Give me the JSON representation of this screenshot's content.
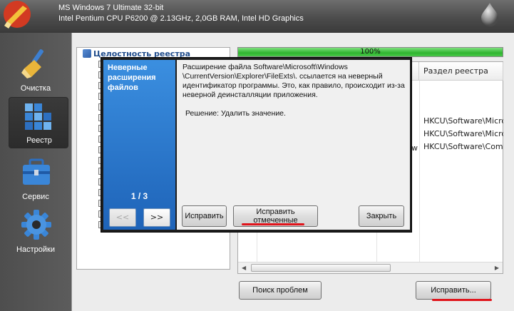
{
  "header": {
    "system_line": "MS Windows 7 Ultimate 32-bit",
    "hardware_line": "Intel Pentium CPU P6200 @ 2.13GHz, 2,0GB RAM, Intel HD Graphics"
  },
  "sidebar": {
    "items": [
      {
        "label": "Очистка",
        "icon": "broom-icon"
      },
      {
        "label": "Реестр",
        "icon": "registry-cubes-icon",
        "active": true
      },
      {
        "label": "Сервис",
        "icon": "toolbox-icon"
      },
      {
        "label": "Настройки",
        "icon": "gear-icon"
      }
    ]
  },
  "tree": {
    "header": "Целостность реестра",
    "checkbox_count": 16
  },
  "progress": {
    "label": "100%",
    "value": 100
  },
  "results": {
    "columns": [
      "Раздел реестра"
    ],
    "rows": [
      {
        "fragment": "",
        "key": "HKCU\\Software\\Micros"
      },
      {
        "fragment": "",
        "key": "HKCU\\Software\\Micros"
      },
      {
        "fragment": "w",
        "key": "HKCU\\Software\\Comm"
      }
    ]
  },
  "buttons": {
    "scan": "Поиск проблем",
    "fix": "Исправить..."
  },
  "popup": {
    "title": "Неверные расширения файлов",
    "page": "1 / 3",
    "prev": "<<",
    "next": ">>",
    "message": "Расширение файла Software\\Microsoft\\Windows \\CurrentVersion\\Explorer\\FileExts\\. ссылается на неверный идентификатор программы. Это, как правило, происходит из-за неверной деинсталляции приложения.",
    "solution": "Решение: Удалить значение.",
    "fix": "Исправить",
    "fix_checked": "Исправить отмеченные",
    "close": "Закрыть"
  },
  "colors": {
    "accent_blue": "#2f7ad6",
    "progress_green": "#2fb52f",
    "annotation_red": "#e0141b"
  }
}
